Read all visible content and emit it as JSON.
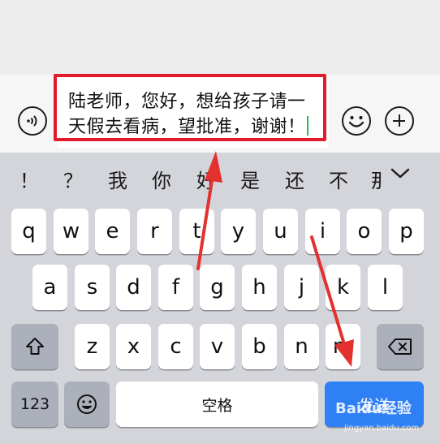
{
  "input": {
    "message_line1": "陆老师，您好，想给孩子请一",
    "message_line2": "天假去看病，望批准，谢谢！"
  },
  "candidates": [
    "！",
    "？",
    "我",
    "你",
    "好",
    "是",
    "还",
    "不",
    "那"
  ],
  "keyboard": {
    "row1": [
      "q",
      "w",
      "e",
      "r",
      "t",
      "y",
      "u",
      "i",
      "o",
      "p"
    ],
    "row2": [
      "a",
      "s",
      "d",
      "f",
      "g",
      "h",
      "j",
      "k",
      "l"
    ],
    "row3": [
      "z",
      "x",
      "c",
      "v",
      "b",
      "n",
      "m"
    ],
    "num_label": "123",
    "space_label": "空格",
    "return_label": "发送"
  },
  "watermark": {
    "text": "Baidu经验",
    "sub": "jingyan.baidu.com"
  },
  "colors": {
    "highlight": "#e21b2c",
    "arrow": "#e3312e",
    "return_key": "#2f7ff5",
    "cursor": "#17c24f"
  },
  "icons": {
    "voice": "voice-icon",
    "emoji": "emoji-icon",
    "plus": "plus-icon",
    "shift": "shift-icon",
    "backspace": "backspace-icon",
    "collapse": "chevron-down-icon"
  }
}
